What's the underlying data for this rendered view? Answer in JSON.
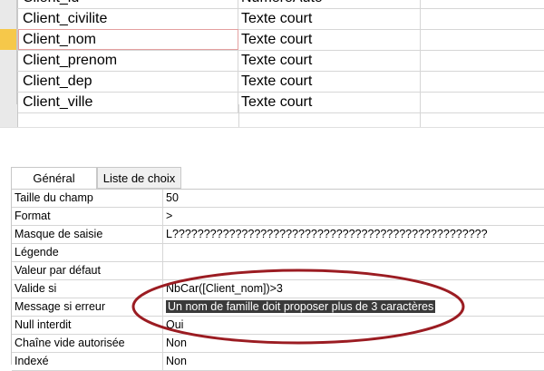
{
  "fields": [
    {
      "name": "Client_id",
      "type": "NuméroAuto"
    },
    {
      "name": "Client_civilite",
      "type": "Texte court"
    },
    {
      "name": "Client_nom",
      "type": "Texte court"
    },
    {
      "name": "Client_prenom",
      "type": "Texte court"
    },
    {
      "name": "Client_dep",
      "type": "Texte court"
    },
    {
      "name": "Client_ville",
      "type": "Texte court"
    }
  ],
  "tabs": {
    "general": "Général",
    "lookup": "Liste de choix"
  },
  "properties": [
    {
      "name": "Taille du champ",
      "value": "50"
    },
    {
      "name": "Format",
      "value": ">"
    },
    {
      "name": "Masque de saisie",
      "value": "L??????????????????????????????????????????????????"
    },
    {
      "name": "Légende",
      "value": ""
    },
    {
      "name": "Valeur par défaut",
      "value": ""
    },
    {
      "name": "Valide si",
      "value": "NbCar([Client_nom])>3"
    },
    {
      "name": "Message si erreur",
      "value": "Un nom de famille doit proposer plus de 3 caractères"
    },
    {
      "name": "Null interdit",
      "value": "Oui"
    },
    {
      "name": "Chaîne vide autorisée",
      "value": "Non"
    },
    {
      "name": "Indexé",
      "value": "Non"
    }
  ],
  "colors": {
    "current_row_marker": "#f6c84a",
    "annotation_ellipse": "#9b1c22",
    "selection_bg": "#3a3a3a"
  }
}
